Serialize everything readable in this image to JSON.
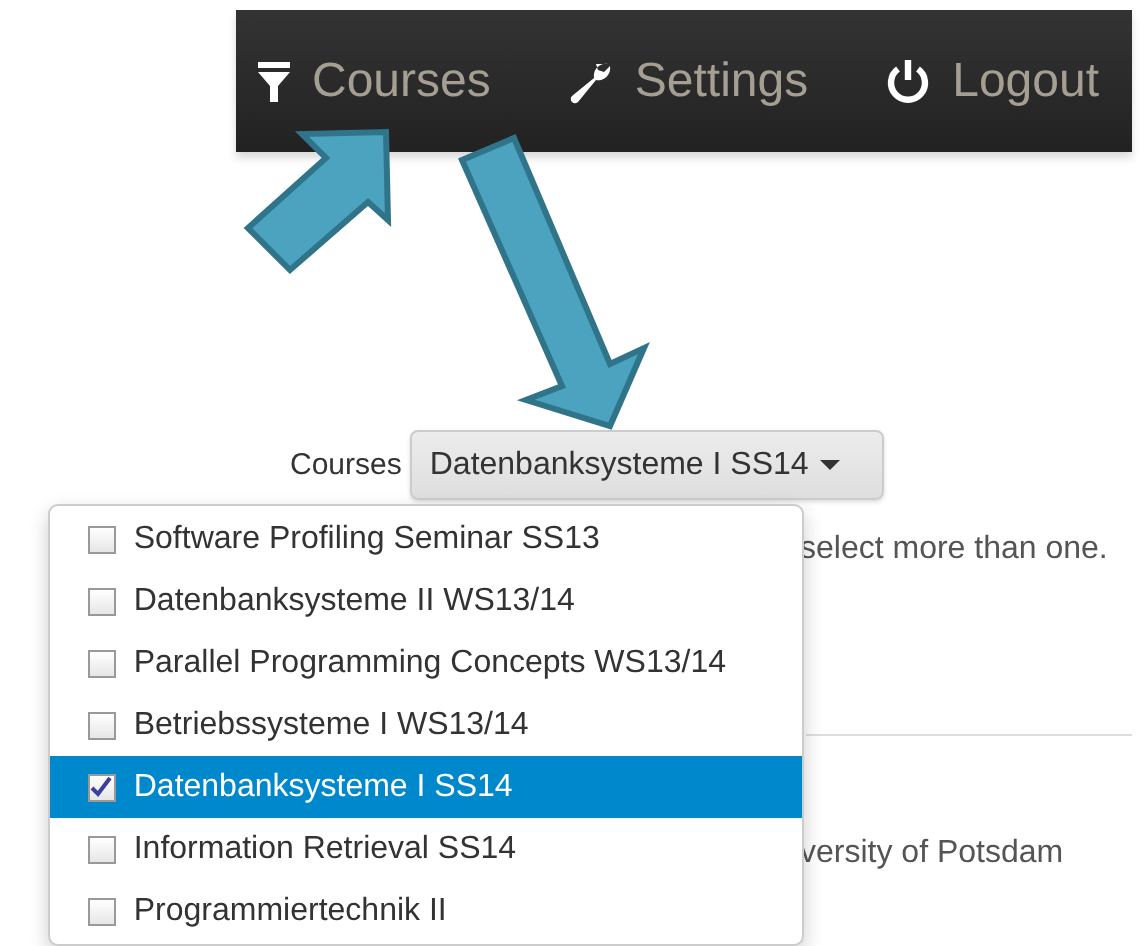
{
  "navbar": {
    "items": [
      {
        "label": "Courses"
      },
      {
        "label": "Settings"
      },
      {
        "label": "Logout"
      }
    ]
  },
  "course_filter": {
    "label": "Courses",
    "button": "Datenbanksysteme I SS14",
    "menu": [
      {
        "label": "Software Profiling Seminar SS13",
        "checked": false,
        "selected": false
      },
      {
        "label": "Datenbanksysteme II WS13/14",
        "checked": false,
        "selected": false
      },
      {
        "label": "Parallel Programming Concepts WS13/14",
        "checked": false,
        "selected": false
      },
      {
        "label": "Betriebssysteme I WS13/14",
        "checked": false,
        "selected": false
      },
      {
        "label": "Datenbanksysteme I SS14",
        "checked": true,
        "selected": true
      },
      {
        "label": "Information Retrieval SS14",
        "checked": false,
        "selected": false
      },
      {
        "label": "Programmiertechnik II",
        "checked": false,
        "selected": false
      }
    ]
  },
  "background_texts": [
    "select more than one.",
    "versity of Potsdam"
  ]
}
